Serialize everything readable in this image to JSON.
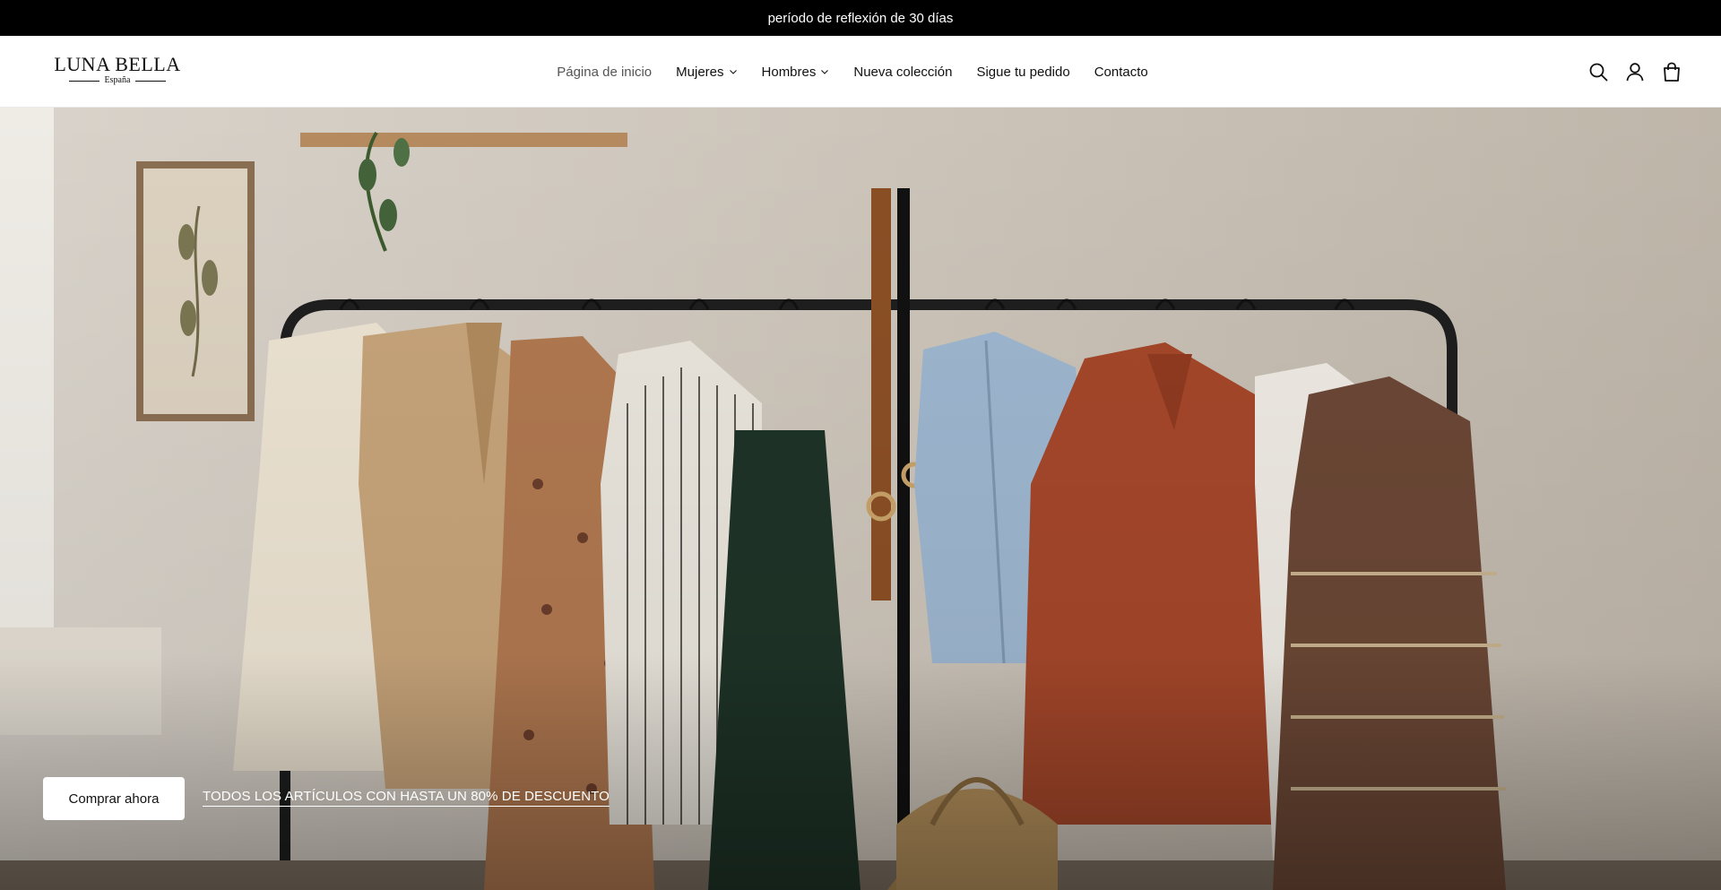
{
  "announcement": {
    "text": "período de reflexión de 30 días"
  },
  "brand": {
    "name": "LUNA BELLA",
    "subtitle": "España"
  },
  "nav": {
    "items": [
      {
        "label": "Página de inicio",
        "active": true,
        "has_dropdown": false
      },
      {
        "label": "Mujeres",
        "active": false,
        "has_dropdown": true
      },
      {
        "label": "Hombres",
        "active": false,
        "has_dropdown": true
      },
      {
        "label": "Nueva colección",
        "active": false,
        "has_dropdown": false
      },
      {
        "label": "Sigue tu pedido",
        "active": false,
        "has_dropdown": false
      },
      {
        "label": "Contacto",
        "active": false,
        "has_dropdown": false
      }
    ]
  },
  "header_icons": [
    "search-icon",
    "account-icon",
    "cart-icon"
  ],
  "hero": {
    "cta_label": "Comprar ahora",
    "promo_link": "TODOS LOS ARTÍCULOS CON HASTA UN 80% DE DESCUENTO"
  },
  "colors": {
    "announcement_bg": "#000000",
    "announcement_text": "#ffffff",
    "header_bg": "#ffffff",
    "nav_active": "#555555",
    "cta_bg": "#ffffff"
  }
}
